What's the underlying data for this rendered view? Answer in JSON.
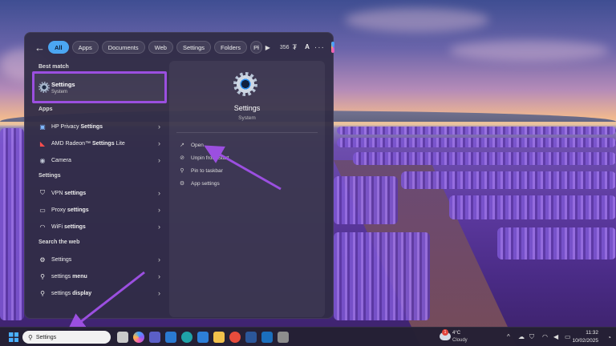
{
  "search_filters": {
    "chips": [
      "All",
      "Apps",
      "Documents",
      "Web",
      "Settings",
      "Folders",
      "Pł"
    ],
    "active": "All",
    "points": "356",
    "account_initial": "A"
  },
  "results": {
    "best_match_label": "Best match",
    "best_match": {
      "title": "Settings",
      "subtitle": "System"
    },
    "apps_label": "Apps",
    "apps": [
      {
        "prefix": "HP Privacy ",
        "highlight": "Settings",
        "suffix": ""
      },
      {
        "prefix": "AMD Radeon™ ",
        "highlight": "Settings",
        "suffix": " Lite"
      },
      {
        "prefix": "Camera",
        "highlight": "",
        "suffix": ""
      }
    ],
    "settings_label": "Settings",
    "settings": [
      {
        "prefix": "VPN ",
        "highlight": "settings",
        "suffix": ""
      },
      {
        "prefix": "Proxy ",
        "highlight": "settings",
        "suffix": ""
      },
      {
        "prefix": "WiFi ",
        "highlight": "settings",
        "suffix": ""
      }
    ],
    "web_label": "Search the web",
    "web": [
      {
        "prefix": "Settings",
        "highlight": "",
        "suffix": ""
      },
      {
        "prefix": "settings ",
        "highlight": "menu",
        "suffix": ""
      },
      {
        "prefix": "settings ",
        "highlight": "display",
        "suffix": ""
      }
    ]
  },
  "detail": {
    "title": "Settings",
    "subtitle": "System",
    "actions": [
      "Open",
      "Unpin from Start",
      "Pin to taskbar",
      "App settings"
    ]
  },
  "taskbar": {
    "search_value": "Settings",
    "weather_badge": "1",
    "weather_temp": "4°C",
    "weather_desc": "Cloudy",
    "time": "11:32",
    "date": "10/02/2025"
  },
  "colors": {
    "accent": "#4ba6f2",
    "annotation": "#9b4fe0"
  }
}
